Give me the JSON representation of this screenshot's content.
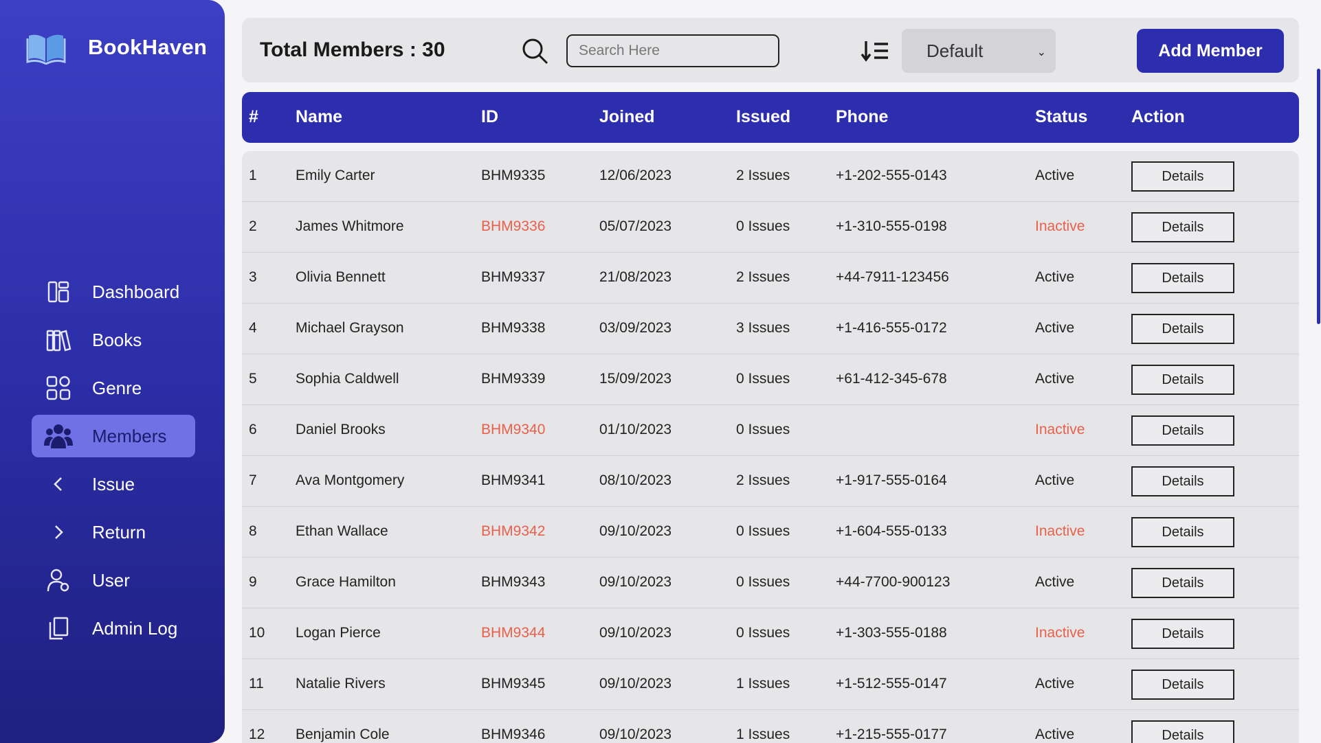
{
  "app": {
    "name": "BookHaven"
  },
  "sidebar": {
    "items": [
      {
        "label": "Dashboard",
        "icon": "dashboard-icon"
      },
      {
        "label": "Books",
        "icon": "books-icon"
      },
      {
        "label": "Genre",
        "icon": "grid-icon"
      },
      {
        "label": "Members",
        "icon": "members-icon",
        "active": true
      },
      {
        "label": "Issue",
        "icon": "chevron-left-icon"
      },
      {
        "label": "Return",
        "icon": "chevron-right-icon"
      },
      {
        "label": "User",
        "icon": "user-icon"
      },
      {
        "label": "Admin Log",
        "icon": "copy-icon"
      }
    ]
  },
  "toolbar": {
    "total_label": "Total Members : 30",
    "search_placeholder": "Search Here",
    "sort_value": "Default",
    "add_button": "Add Member"
  },
  "table": {
    "headers": [
      "#",
      "Name",
      "ID",
      "Joined",
      "Issued",
      "Phone",
      "Status",
      "Action"
    ],
    "rows": [
      {
        "num": "1",
        "name": "Emily Carter",
        "id": "BHM9335",
        "joined": "12/06/2023",
        "issued": "2 Issues",
        "phone": "+1-202-555-0143",
        "status": "Active",
        "action": "Details"
      },
      {
        "num": "2",
        "name": "James Whitmore",
        "id": "BHM9336",
        "joined": "05/07/2023",
        "issued": "0 Issues",
        "phone": "+1-310-555-0198",
        "status": "Inactive",
        "action": "Details"
      },
      {
        "num": "3",
        "name": "Olivia Bennett",
        "id": "BHM9337",
        "joined": "21/08/2023",
        "issued": "2 Issues",
        "phone": "+44-7911-123456",
        "status": "Active",
        "action": "Details"
      },
      {
        "num": "4",
        "name": "Michael Grayson",
        "id": "BHM9338",
        "joined": "03/09/2023",
        "issued": "3 Issues",
        "phone": "+1-416-555-0172",
        "status": "Active",
        "action": "Details"
      },
      {
        "num": "5",
        "name": "Sophia Caldwell",
        "id": "BHM9339",
        "joined": "15/09/2023",
        "issued": "0 Issues",
        "phone": "+61-412-345-678",
        "status": "Active",
        "action": "Details"
      },
      {
        "num": "6",
        "name": "Daniel Brooks",
        "id": "BHM9340",
        "joined": "01/10/2023",
        "issued": "0 Issues",
        "phone": "",
        "status": "Inactive",
        "action": "Details"
      },
      {
        "num": "7",
        "name": "Ava Montgomery",
        "id": "BHM9341",
        "joined": "08/10/2023",
        "issued": "2 Issues",
        "phone": "+1-917-555-0164",
        "status": "Active",
        "action": "Details"
      },
      {
        "num": "8",
        "name": "Ethan Wallace",
        "id": "BHM9342",
        "joined": "09/10/2023",
        "issued": "0 Issues",
        "phone": "+1-604-555-0133",
        "status": "Inactive",
        "action": "Details"
      },
      {
        "num": "9",
        "name": "Grace Hamilton",
        "id": "BHM9343",
        "joined": "09/10/2023",
        "issued": "0 Issues",
        "phone": "+44-7700-900123",
        "status": "Active",
        "action": "Details"
      },
      {
        "num": "10",
        "name": "Logan Pierce",
        "id": "BHM9344",
        "joined": "09/10/2023",
        "issued": "0 Issues",
        "phone": "+1-303-555-0188",
        "status": "Inactive",
        "action": "Details"
      },
      {
        "num": "11",
        "name": "Natalie Rivers",
        "id": "BHM9345",
        "joined": "09/10/2023",
        "issued": "1 Issues",
        "phone": "+1-512-555-0147",
        "status": "Active",
        "action": "Details"
      },
      {
        "num": "12",
        "name": "Benjamin Cole",
        "id": "BHM9346",
        "joined": "09/10/2023",
        "issued": "1 Issues",
        "phone": "+1-215-555-0177",
        "status": "Active",
        "action": "Details"
      }
    ]
  },
  "colors": {
    "primary": "#2c2eae",
    "inactive": "#e8604a",
    "sidebar_active": "#6f71e4"
  }
}
